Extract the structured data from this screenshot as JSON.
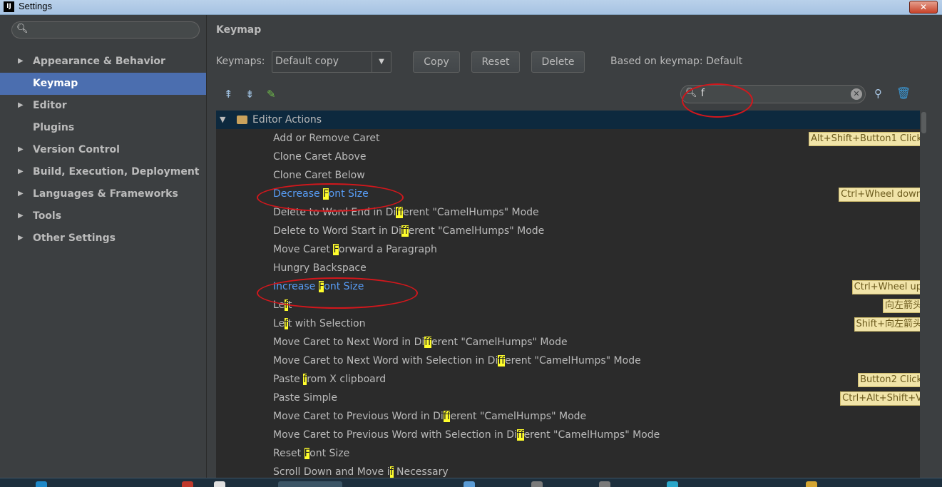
{
  "window": {
    "title": "Settings",
    "close_glyph": "✕",
    "app_icon_text": "IJ"
  },
  "sidebar": {
    "search_placeholder": "",
    "items": [
      {
        "label": "Appearance & Behavior",
        "expandable": true,
        "selected": false
      },
      {
        "label": "Keymap",
        "expandable": false,
        "selected": true
      },
      {
        "label": "Editor",
        "expandable": true,
        "selected": false
      },
      {
        "label": "Plugins",
        "expandable": false,
        "selected": false
      },
      {
        "label": "Version Control",
        "expandable": true,
        "selected": false
      },
      {
        "label": "Build, Execution, Deployment",
        "expandable": true,
        "selected": false
      },
      {
        "label": "Languages & Frameworks",
        "expandable": true,
        "selected": false
      },
      {
        "label": "Tools",
        "expandable": true,
        "selected": false
      },
      {
        "label": "Other Settings",
        "expandable": true,
        "selected": false
      }
    ]
  },
  "keymap": {
    "title": "Keymap",
    "keymaps_label": "Keymaps:",
    "selected_keymap": "Default copy",
    "copy_label": "Copy",
    "reset_label": "Reset",
    "delete_label": "Delete",
    "based_on": "Based on keymap: Default",
    "search_value": "f"
  },
  "tree": {
    "group_label": "Editor Actions",
    "actions": [
      {
        "label": "Add or Remove Caret",
        "shortcut": "Alt+Shift+Button1 Click",
        "highlight": false
      },
      {
        "label": "Clone Caret Above",
        "shortcut": "",
        "highlight": false
      },
      {
        "label": "Clone Caret Below",
        "shortcut": "",
        "highlight": false
      },
      {
        "label": "Decrease Font Size",
        "shortcut": "Ctrl+Wheel down",
        "highlight": true
      },
      {
        "label": "Delete to Word End in Different \"CamelHumps\" Mode",
        "shortcut": "",
        "highlight": false
      },
      {
        "label": "Delete to Word Start in Different \"CamelHumps\" Mode",
        "shortcut": "",
        "highlight": false
      },
      {
        "label": "Move Caret Forward a Paragraph",
        "shortcut": "",
        "highlight": false
      },
      {
        "label": "Hungry Backspace",
        "shortcut": "",
        "highlight": false
      },
      {
        "label": "Increase Font Size",
        "shortcut": "Ctrl+Wheel up",
        "highlight": true
      },
      {
        "label": "Left",
        "shortcut": "向左箭头",
        "highlight": false
      },
      {
        "label": "Left with Selection",
        "shortcut": "Shift+向左箭头",
        "highlight": false
      },
      {
        "label": "Move Caret to Next Word in Different \"CamelHumps\" Mode",
        "shortcut": "",
        "highlight": false
      },
      {
        "label": "Move Caret to Next Word with Selection in Different \"CamelHumps\" Mode",
        "shortcut": "",
        "highlight": false
      },
      {
        "label": "Paste from X clipboard",
        "shortcut": "Button2 Click",
        "highlight": false
      },
      {
        "label": "Paste Simple",
        "shortcut": "Ctrl+Alt+Shift+V",
        "highlight": false
      },
      {
        "label": "Move Caret to Previous Word in Different \"CamelHumps\" Mode",
        "shortcut": "",
        "highlight": false
      },
      {
        "label": "Move Caret to Previous Word with Selection in Different \"CamelHumps\" Mode",
        "shortcut": "",
        "highlight": false
      },
      {
        "label": "Reset Font Size",
        "shortcut": "",
        "highlight": false
      },
      {
        "label": "Scroll Down and Move if Necessary",
        "shortcut": "",
        "highlight": false
      }
    ]
  },
  "colors": {
    "background": "#3c3f41",
    "tree_background": "#2b2b2b",
    "selection": "#4b6eaf",
    "group_row": "#0d293e",
    "link_blue": "#589df6",
    "match_highlight": "#fffd2c",
    "annotation_red": "#d3171c"
  }
}
